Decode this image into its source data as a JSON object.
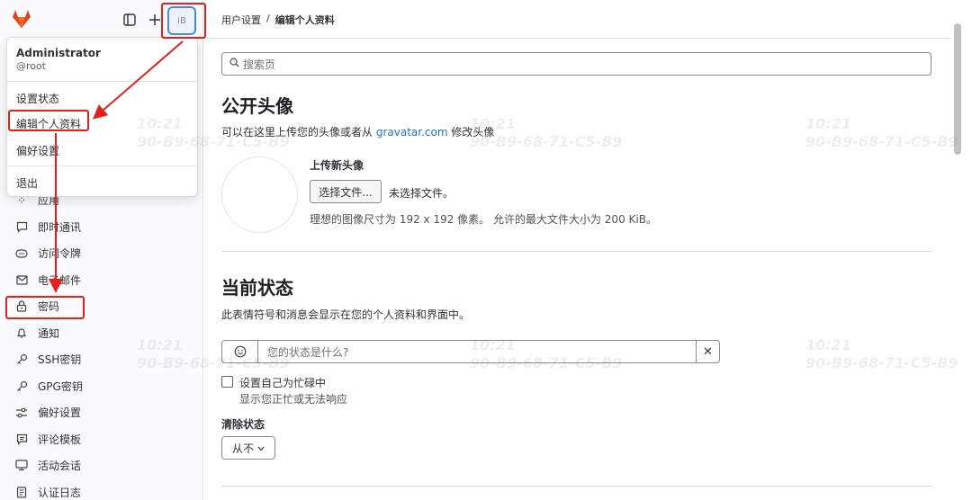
{
  "sidebar": {
    "nav_items": [
      {
        "label": "应用",
        "icon": "applications-icon"
      },
      {
        "label": "即时通讯",
        "icon": "chat-icon"
      },
      {
        "label": "访问令牌",
        "icon": "token-icon"
      },
      {
        "label": "电子邮件",
        "icon": "mail-icon"
      },
      {
        "label": "密码",
        "icon": "lock-icon"
      },
      {
        "label": "通知",
        "icon": "bell-icon"
      },
      {
        "label": "SSH密钥",
        "icon": "key-icon"
      },
      {
        "label": "GPG密钥",
        "icon": "key-icon"
      },
      {
        "label": "偏好设置",
        "icon": "preferences-icon"
      },
      {
        "label": "评论模板",
        "icon": "comment-template-icon"
      },
      {
        "label": "活动会话",
        "icon": "monitor-icon"
      },
      {
        "label": "认证日志",
        "icon": "log-icon"
      }
    ]
  },
  "user_menu": {
    "name": "Administrator",
    "username": "@root",
    "items": [
      "设置状态",
      "编辑个人资料",
      "偏好设置",
      "退出"
    ]
  },
  "avatar_alt": "iB",
  "breadcrumb": {
    "parent": "用户设置",
    "separator": "/",
    "current": "编辑个人资料"
  },
  "search": {
    "placeholder": "搜索页"
  },
  "avatar_section": {
    "title": "公开头像",
    "desc_before": "可以在这里上传您的头像或者从",
    "desc_link": "gravatar.com",
    "desc_after": "修改头像",
    "upload_title": "上传新头像",
    "choose_file": "选择文件...",
    "no_file": "未选择文件。",
    "hint": "理想的图像尺寸为 192 x 192 像素。 允许的最大文件大小为 200 KiB。"
  },
  "status_section": {
    "title": "当前状态",
    "desc": "此表情符号和消息会显示在您的个人资料和界面中。",
    "placeholder": "您的状态是什么?",
    "busy_label": "设置自己为忙碌中",
    "busy_hint": "显示您正忙或无法响应",
    "clear_label": "清除状态",
    "clear_value": "从不"
  },
  "watermark": {
    "time": "10:21",
    "mac": "90-B9-68-71-C5-B9"
  },
  "colors": {
    "highlight": "#e51f1f",
    "link": "#1f75cb",
    "logo": "#e24329"
  }
}
